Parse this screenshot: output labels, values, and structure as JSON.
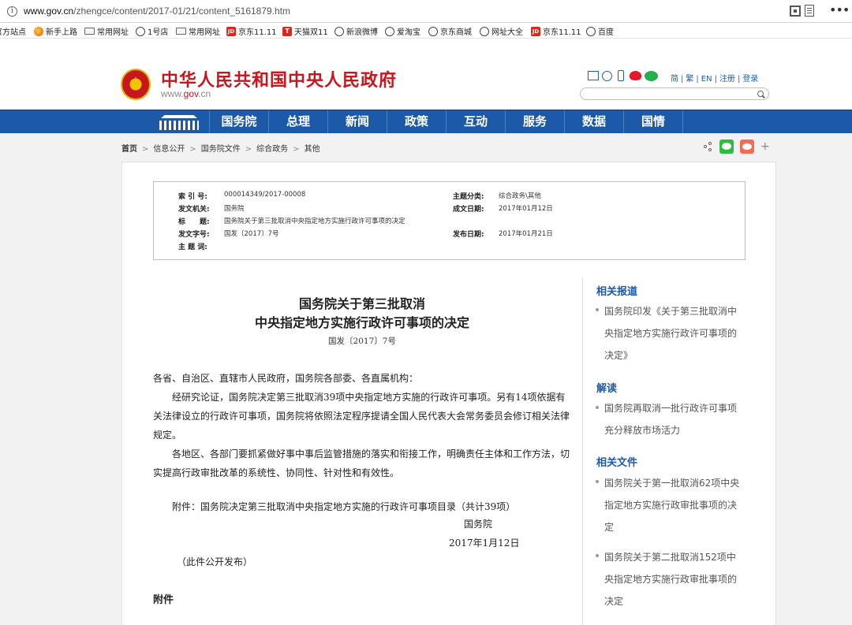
{
  "browser": {
    "url_domain": "www.gov.cn",
    "url_path": "/zhengce/content/2017-01/21/content_5161879.htm",
    "bookmarks": [
      {
        "label": "官方站点",
        "icon": "globe-icon"
      },
      {
        "label": "新手上路",
        "icon": "firefox-icon"
      },
      {
        "label": "常用网址",
        "icon": "folder-icon"
      },
      {
        "label": "1号店",
        "icon": "globe-icon"
      },
      {
        "label": "常用网址",
        "icon": "folder-icon"
      },
      {
        "label": "京东11.11",
        "icon": "jd-icon"
      },
      {
        "label": "天猫双11",
        "icon": "tmall-icon"
      },
      {
        "label": "新浪微博",
        "icon": "globe-icon"
      },
      {
        "label": "爱淘宝",
        "icon": "globe-icon"
      },
      {
        "label": "京东商城",
        "icon": "globe-icon"
      },
      {
        "label": "网址大全",
        "icon": "globe-icon"
      },
      {
        "label": "京东11.11",
        "icon": "jd-icon"
      },
      {
        "label": "百度",
        "icon": "globe-icon"
      }
    ],
    "more": "•••"
  },
  "site": {
    "title": "中华人民共和国中央人民政府",
    "domain_pre": "www.",
    "domain_mid": "gov",
    "domain_post": ".cn",
    "links": [
      "简",
      "繁",
      "EN",
      "注册",
      "登录"
    ],
    "search_placeholder": ""
  },
  "nav": [
    "国务院",
    "总理",
    "新闻",
    "政策",
    "互动",
    "服务",
    "数据",
    "国情"
  ],
  "breadcrumb": [
    "首页",
    "信息公开",
    "国务院文件",
    "综合政务",
    "其他"
  ],
  "meta": {
    "index_k": "索 引 号:",
    "index_v": "000014349/2017-00008",
    "topic_k": "主题分类:",
    "topic_v": "综合政务\\其他",
    "org_k": "发文机关:",
    "org_v": "国务院",
    "made_k": "成文日期:",
    "made_v": "2017年01月12日",
    "title_k": "标　　题:",
    "title_v": "国务院关于第三批取消中央指定地方实施行政许可事项的决定",
    "num_k": "发文字号:",
    "num_v": "国发〔2017〕7号",
    "pub_k": "发布日期:",
    "pub_v": "2017年01月21日",
    "kw_k": "主 题 词:",
    "kw_v": ""
  },
  "doc": {
    "title_line1": "国务院关于第三批取消",
    "title_line2": "中央指定地方实施行政许可事项的决定",
    "number": "国发〔2017〕7号",
    "p1": "各省、自治区、直辖市人民政府，国务院各部委、各直属机构：",
    "p2": "经研究论证，国务院决定第三批取消39项中央指定地方实施的行政许可事项。另有14项依据有关法律设立的行政许可事项，国务院将依照法定程序提请全国人民代表大会常务委员会修订相关法律规定。",
    "p3": "各地区、各部门要抓紧做好事中事后监管措施的落实和衔接工作，明确责任主体和工作方法，切实提高行政审批改革的系统性、协同性、针对性和有效性。",
    "attachment": "附件：国务院决定第三批取消中央指定地方实施的行政许可事项目录（共计39项）",
    "signer": "国务院",
    "date": "2017年1月12日",
    "publish_note": "（此件公开发布）",
    "annex_heading": "附件"
  },
  "sidebar": {
    "related_title": "相关报道",
    "related": [
      "国务院印发《关于第三批取消中央指定地方实施行政许可事项的决定》"
    ],
    "interp_title": "解读",
    "interp": [
      "国务院再取消一批行政许可事项 充分释放市场活力"
    ],
    "files_title": "相关文件",
    "files": [
      "国务院关于第一批取消62项中央指定地方实施行政审批事项的决定",
      "国务院关于第二批取消152项中央指定地方实施行政审批事项的决定"
    ]
  }
}
